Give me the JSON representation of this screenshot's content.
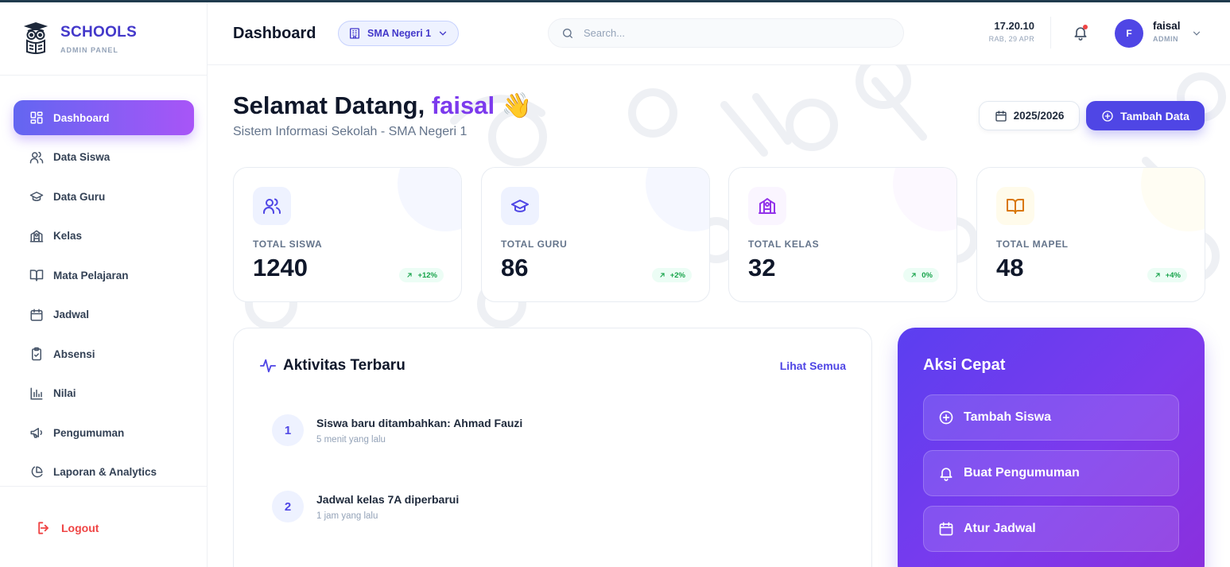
{
  "brand": {
    "title": "SCHOOLS",
    "subtitle": "ADMIN PANEL",
    "logo_icon": "owl-book-icon"
  },
  "sidebar": {
    "items": [
      {
        "label": "Dashboard",
        "icon": "dashboard-grid-icon",
        "active": true
      },
      {
        "label": "Data Siswa",
        "icon": "users-icon"
      },
      {
        "label": "Data Guru",
        "icon": "graduation-cap-icon"
      },
      {
        "label": "Kelas",
        "icon": "school-building-icon"
      },
      {
        "label": "Mata Pelajaran",
        "icon": "book-open-icon"
      },
      {
        "label": "Jadwal",
        "icon": "calendar-icon"
      },
      {
        "label": "Absensi",
        "icon": "clipboard-check-icon"
      },
      {
        "label": "Nilai",
        "icon": "bar-chart-icon"
      },
      {
        "label": "Pengumuman",
        "icon": "megaphone-icon"
      },
      {
        "label": "Laporan & Analytics",
        "icon": "pie-chart-icon"
      }
    ],
    "logout": "Logout"
  },
  "header": {
    "title": "Dashboard",
    "school": "SMA Negeri 1",
    "search_placeholder": "Search...",
    "time": "17.20.10",
    "date": "RAB, 29 APR",
    "user": {
      "initial": "F",
      "name": "faisal",
      "role": "ADMIN"
    }
  },
  "main": {
    "welcome_prefix": "Selamat Datang, ",
    "welcome_name": "faisal",
    "welcome_emoji": "👋",
    "subtitle": "Sistem Informasi Sekolah - SMA Negeri 1",
    "year": "2025/2026",
    "add_button": "Tambah Data",
    "stats": [
      {
        "label": "TOTAL SISWA",
        "value": "1240",
        "change": "+12%",
        "color": "#4f46e5",
        "bg": "#eef2ff"
      },
      {
        "label": "TOTAL GURU",
        "value": "86",
        "change": "+2%",
        "color": "#4f46e5",
        "bg": "#eef2ff"
      },
      {
        "label": "TOTAL KELAS",
        "value": "32",
        "change": "0%",
        "color": "#9333ea",
        "bg": "#faf5ff"
      },
      {
        "label": "TOTAL MAPEL",
        "value": "48",
        "change": "+4%",
        "color": "#d97706",
        "bg": "#fffbeb"
      }
    ],
    "activity": {
      "title": "Aktivitas Terbaru",
      "link": "Lihat Semua",
      "items": [
        {
          "num": "1",
          "text": "Siswa baru ditambahkan: Ahmad Fauzi",
          "time": "5 menit yang lalu"
        },
        {
          "num": "2",
          "text": "Jadwal kelas 7A diperbarui",
          "time": "1 jam yang lalu"
        }
      ]
    },
    "quick": {
      "title": "Aksi Cepat",
      "actions": [
        {
          "label": "Tambah Siswa",
          "icon": "plus-circle-icon"
        },
        {
          "label": "Buat Pengumuman",
          "icon": "bell-icon"
        },
        {
          "label": "Atur Jadwal",
          "icon": "calendar-icon"
        }
      ]
    }
  }
}
